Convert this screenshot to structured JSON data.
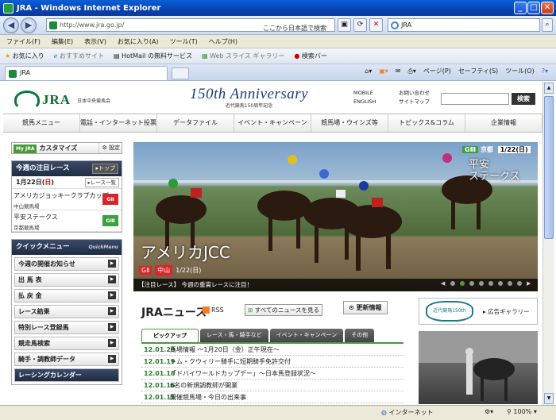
{
  "browser": {
    "title": "JRA - Windows Internet Explorer",
    "url": "http://www.jra.go.jp/",
    "address_hint": "ここから日本語で検索(JWord)",
    "search_value": "JRA",
    "menu": [
      "ファイル(F)",
      "編集(E)",
      "表示(V)",
      "お気に入り(A)",
      "ツール(T)",
      "ヘルプ(H)"
    ],
    "favorites": [
      "お気に入り",
      "おすすめサイト",
      "HotMail の無料サービス",
      "Web スライス ギャラリー",
      "検索バー"
    ],
    "tab_label": "JRA",
    "commands": [
      "ページ(P)",
      "セーフティ(S)",
      "ツール(O)"
    ],
    "status_zone": "インターネット",
    "zoom": "100%"
  },
  "site": {
    "logo": "JRA",
    "org": "日本中央競馬会",
    "anniversary": "150th Anniversary",
    "anniversary_sub": "近代競馬150周年記念",
    "links": [
      "MOBILE",
      "お問い合わせ",
      "ENGLISH",
      "サイトマップ"
    ],
    "search_button": "検索",
    "gnav": [
      "競馬メニュー",
      "電話・インターネット投票",
      "データファイル",
      "イベント・キャンペーン",
      "競馬場・ウインズ等",
      "トピックス&コラム",
      "企業情報"
    ],
    "customize": {
      "badge": "My JRA",
      "label": "カスタマイズ",
      "settings": "設定"
    },
    "races_box": {
      "title": "今週の注目レース",
      "top": "トップ",
      "date": "1月22日(",
      "date_day": "日",
      "date_end": ")",
      "list": "レース一覧",
      "races": [
        {
          "name": "アメリカジョッキークラブカップ",
          "place": "中山競馬場",
          "grade": "GⅡ",
          "color": "#d8262a"
        },
        {
          "name": "平安ステークス",
          "place": "京都競馬場",
          "grade": "GⅢ",
          "color": "#3aa040"
        }
      ]
    },
    "quick": {
      "title": "クイックメニュー",
      "title_en": "QuickMenu",
      "items": [
        "今週の開催お知らせ",
        "出 馬 表",
        "払 戻 金",
        "レース結果",
        "特別レース登録馬",
        "競走馬検索",
        "騎手・調教師データ",
        "レーシングカレンダー"
      ]
    },
    "hero": {
      "left_title": "アメリカJCC",
      "left_grade": "GⅡ",
      "left_place": "中山",
      "left_date": "1/22(日)",
      "right_grade": "GⅢ",
      "right_place": "京都",
      "right_date": "1/22(日)",
      "right_title_1": "平安",
      "right_title_2": "ステークス",
      "caption": "【注目レース】 今週の重賞レースに注目！"
    },
    "news": {
      "title": "JRAニュース",
      "rss": "RSS",
      "all": "すべてのニュースを見る",
      "updates": "更新情報",
      "tabs": [
        "ピックアップ",
        "レース・馬・騎手など",
        "イベント・キャンペーン",
        "その他"
      ],
      "items": [
        {
          "date": "12.01.20",
          "text": "馬場情報 ～1月20日（金）正午現在～"
        },
        {
          "date": "12.01.19",
          "text": "トム・クウィリー騎手に短期騎手免許交付"
        },
        {
          "date": "12.01.18",
          "text": "「ドバイワールドカップデー」～日本馬登録状況～"
        },
        {
          "date": "12.01.16",
          "text": "6名の新規調教師が開業"
        },
        {
          "date": "12.01.15",
          "text": "開催競馬場・今日の出来事"
        }
      ]
    },
    "gallery": {
      "badge": "近代競馬150th",
      "label": "広告ギャラリー"
    }
  }
}
